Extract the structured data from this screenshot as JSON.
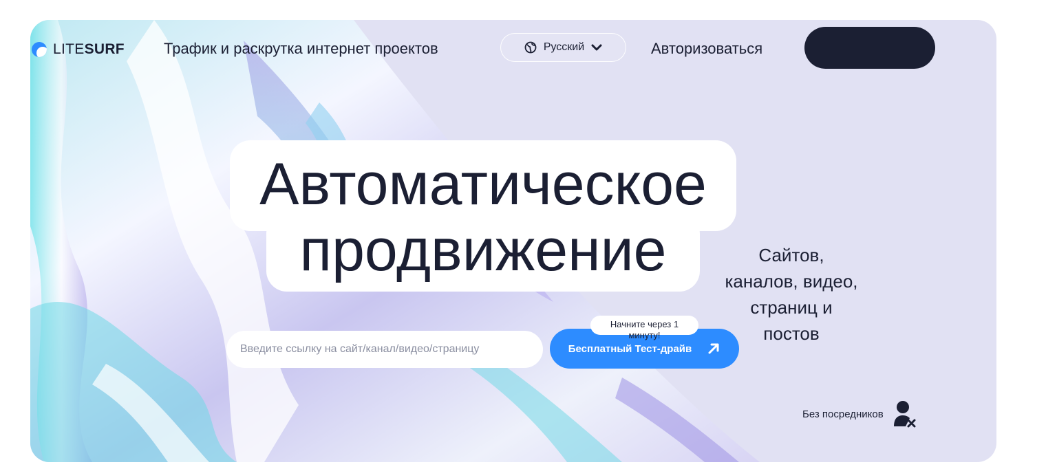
{
  "header": {
    "logo_light": "LITE",
    "logo_bold": "SURF",
    "tagline": "Трафик и раскрутка интернет проектов",
    "language": {
      "label": "Русский",
      "icon": "globe-icon",
      "dropdown_icon": "chevron-down-icon"
    },
    "login_label": "Авторизоваться",
    "cta_label": ""
  },
  "hero": {
    "headline_line1": "Автоматическое",
    "headline_line2": "продвижение",
    "side_line1": "Сайтов,",
    "side_line2": "каналов, видео,",
    "side_line3": "страниц и",
    "side_line4": "постов",
    "url_placeholder": "Введите ссылку на сайт/канал/видео/страницу",
    "url_value": "",
    "tooltip_line1": "Начните через 1",
    "tooltip_line2": "минуту!",
    "test_drive_label": "Бесплатный Тест-драйв",
    "test_drive_icon": "arrow-up-right-icon",
    "no_intermediaries_label": "Без посредников",
    "no_intermediaries_icon": "user-x-icon"
  },
  "colors": {
    "accent": "#2d8cff",
    "dark": "#1b1f33",
    "hero_bg": "#e1e1f3",
    "white": "#ffffff"
  }
}
